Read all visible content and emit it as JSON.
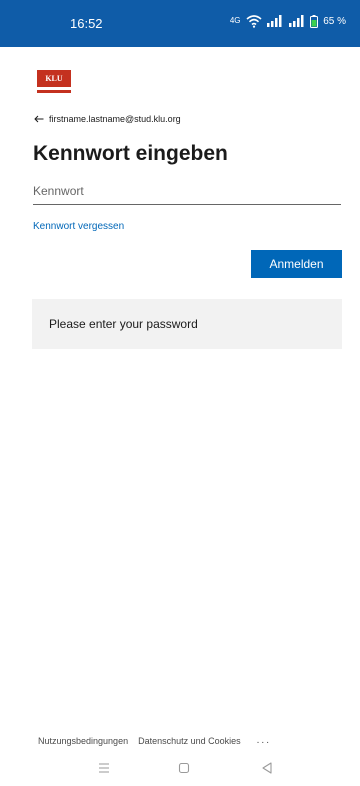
{
  "status_bar": {
    "time": "16:52",
    "network": "4G",
    "battery": "65 %"
  },
  "logo": {
    "text": "KLU"
  },
  "identity": {
    "email": "firstname.lastname@stud.klu.org"
  },
  "title": "Kennwort eingeben",
  "password_field": {
    "value": "",
    "placeholder": "Kennwort"
  },
  "forgot_link": "Kennwort vergessen",
  "signin_button": "Anmelden",
  "message": "Please enter your password",
  "footer": {
    "terms": "Nutzungsbedingungen",
    "privacy": "Datenschutz und Cookies",
    "more": "..."
  },
  "colors": {
    "status_bar_bg": "#0f5ca8",
    "accent": "#0067b8",
    "logo_red": "#c4311f",
    "message_bg": "#f2f2f2"
  },
  "icons": [
    "back-arrow-icon",
    "wifi-icon",
    "signal-icon",
    "battery-icon",
    "nav-menu-icon",
    "nav-home-icon",
    "nav-back-icon"
  ]
}
